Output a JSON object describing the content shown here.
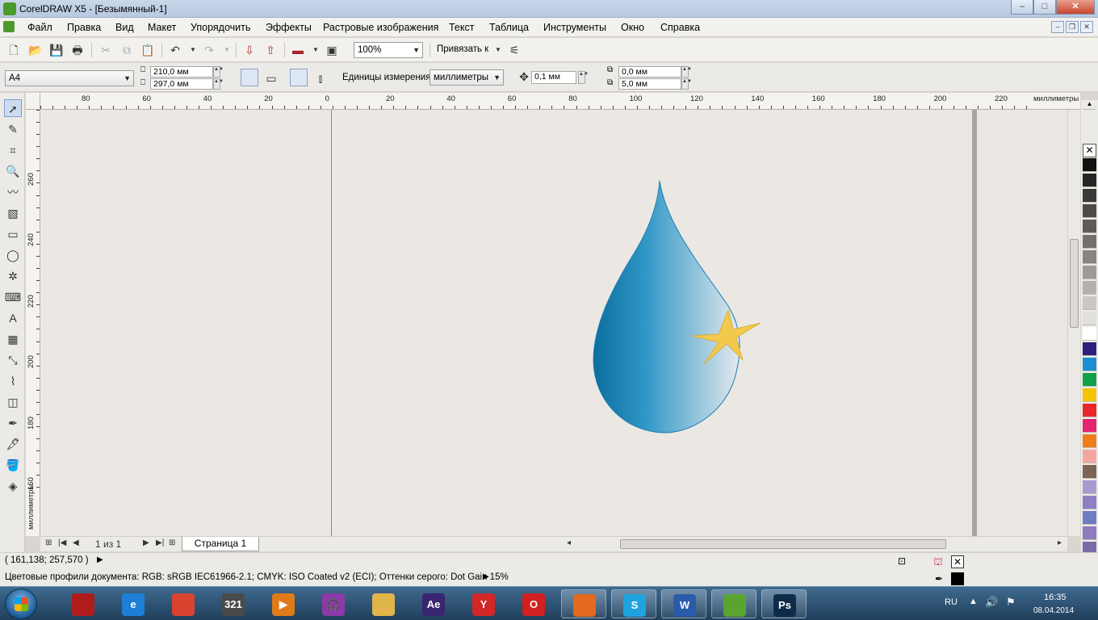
{
  "window": {
    "title": "CorelDRAW X5 - [Безымянный-1]",
    "controls": [
      "–",
      "□",
      "✕"
    ]
  },
  "menu": [
    "Файл",
    "Правка",
    "Вид",
    "Макет",
    "Упорядочить",
    "Эффекты",
    "Растровые изображения",
    "Текст",
    "Таблица",
    "Инструменты",
    "Окно",
    "Справка"
  ],
  "doc_controls": [
    "–",
    "❐",
    "✕"
  ],
  "toolbar": {
    "zoom": "100%",
    "snap_label": "Привязать к"
  },
  "property_bar": {
    "paper_size": "A4",
    "width": "210,0 мм",
    "height": "297,0 мм",
    "units_label": "Единицы измерения:",
    "units_value": "миллиметры",
    "nudge": "0,1 мм",
    "dup_x": "0,0 мм",
    "dup_y": "5,0 мм"
  },
  "ruler": {
    "h_labels": [
      "80",
      "60",
      "40",
      "20",
      "0",
      "20",
      "40",
      "60",
      "80",
      "100",
      "120",
      "140",
      "160",
      "180",
      "200",
      "220"
    ],
    "h_unit": "миллиметры",
    "v_labels": [
      "260",
      "240",
      "220",
      "200",
      "180",
      "160"
    ],
    "v_unit": "миллиметры"
  },
  "palette_colors": [
    "#111111",
    "#262626",
    "#3a3a3a",
    "#4d4a47",
    "#5f5c58",
    "#73706b",
    "#888580",
    "#9e9b96",
    "#b4b1ac",
    "#cbc8c3",
    "#e2e0dc",
    "#ffffff",
    "#2e1f7a",
    "#1b8fcf",
    "#11a04a",
    "#f5c400",
    "#e8262b",
    "#e5246f",
    "#f07d1b",
    "#f3a6a0",
    "#7b6452",
    "#a79bd2",
    "#8c7fc4",
    "#6e7cc2",
    "#8e7bc0",
    "#7a6aaa"
  ],
  "drawing": {
    "drop_colors": [
      "#0a6f9f",
      "#2f96c6",
      "#e4e9ee"
    ],
    "star_color": "#f2c94c"
  },
  "pagenav": {
    "page_count": "1 из 1",
    "page_tab": "Страница 1"
  },
  "status": {
    "coords": "( 161,138; 257,570 )",
    "profiles": "Цветовые профили документа: RGB: sRGB IEC61966-2.1; CMYK: ISO Coated v2 (ECI); Оттенки серого: Dot Gain 15%"
  },
  "taskbar": {
    "lang": "RU",
    "time": "16:35",
    "date": "08.04.2014",
    "apps": [
      {
        "name": "Adobe Creative Cloud",
        "label": "",
        "color": "#b01c1c"
      },
      {
        "name": "Internet Explorer",
        "label": "e",
        "color": "#1e7fd6"
      },
      {
        "name": "Chrome",
        "label": "",
        "color": "#d8432f"
      },
      {
        "name": "Media Player Classic",
        "label": "321",
        "color": "#4a4a4a"
      },
      {
        "name": "Video Converter",
        "label": "▶",
        "color": "#e07b1a"
      },
      {
        "name": "Audio",
        "label": "🎧",
        "color": "#8b3aa8"
      },
      {
        "name": "Explorer",
        "label": "",
        "color": "#e0b44a"
      },
      {
        "name": "After Effects",
        "label": "Ae",
        "color": "#3b2470"
      },
      {
        "name": "Yandex Browser",
        "label": "Y",
        "color": "#d32626"
      },
      {
        "name": "Opera",
        "label": "O",
        "color": "#d21f1f"
      },
      {
        "name": "Firefox",
        "label": "",
        "color": "#e36a1e"
      },
      {
        "name": "Skype",
        "label": "S",
        "color": "#1fa3e0"
      },
      {
        "name": "Word",
        "label": "W",
        "color": "#2a5ba8"
      },
      {
        "name": "CorelDRAW",
        "label": "",
        "color": "#5aa52f"
      },
      {
        "name": "Photoshop",
        "label": "Ps",
        "color": "#0f2b4a"
      }
    ]
  }
}
